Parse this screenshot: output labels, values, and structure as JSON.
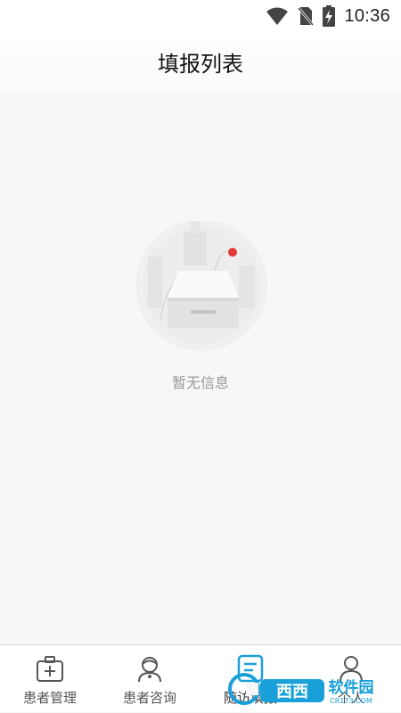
{
  "status_bar": {
    "time": "10:36",
    "icons": [
      "wifi-icon",
      "no-sim-icon",
      "battery-charging-icon"
    ]
  },
  "header": {
    "title": "填报列表"
  },
  "content": {
    "empty_state": {
      "icon": "empty-box-icon",
      "text": "暂无信息"
    }
  },
  "tabbar": {
    "tabs": [
      {
        "label": "患者管理",
        "icon": "medical-kit-icon",
        "active": false
      },
      {
        "label": "患者咨询",
        "icon": "doctor-avatar-icon",
        "active": false
      },
      {
        "label": "随访填报",
        "icon": "form-report-icon",
        "active": true
      },
      {
        "label": "个人",
        "icon": "person-icon",
        "active": false
      }
    ]
  },
  "colors": {
    "accent": "#1aa0d8",
    "background": "#f7f7f7",
    "empty_text": "#999999",
    "notification_dot": "#e53935"
  },
  "watermark": {
    "brand": "西西软件园",
    "domain": "CR173.COM"
  }
}
